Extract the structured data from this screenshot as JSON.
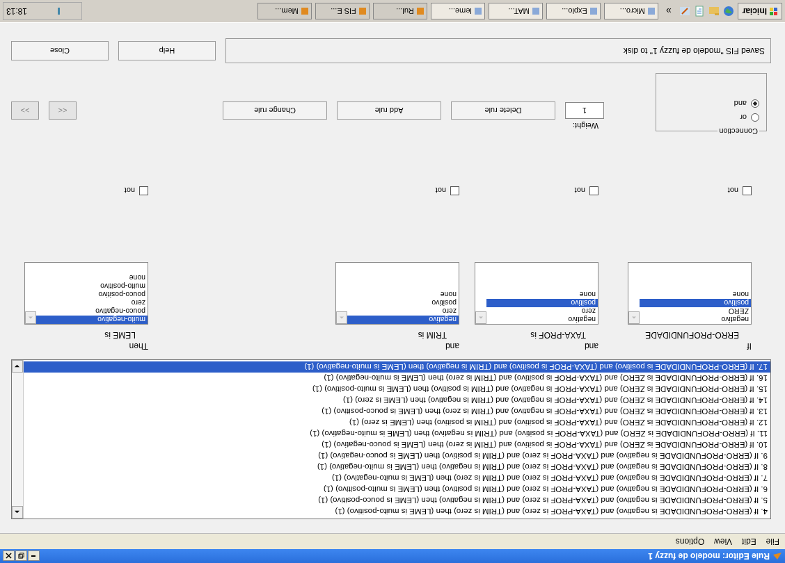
{
  "window": {
    "title": "Rule Editor: modelo de fuzzy 1"
  },
  "menu": [
    "File",
    "Edit",
    "View",
    "Options"
  ],
  "rules": [
    {
      "text": "4. If (ERRO-PROFUNDIDADE is negativo) and (TAXA-PROF is zero) and (TRIM is zero) then (LEME is muito-positivo) (1)",
      "selected": false
    },
    {
      "text": "5. If (ERRO-PROFUNDIDADE is negativo) and (TAXA-PROF is zero) and (TRIM is negativo) then (LEME is pouco-positivo) (1)",
      "selected": false
    },
    {
      "text": "6. If (ERRO-PROFUNDIDADE is negativo) and (TAXA-PROF is zero) and (TRIM is positivo) then (LEME is muito-positivo) (1)",
      "selected": false
    },
    {
      "text": "7. If (ERRO-PROFUNDIDADE is negativo) and (TAXA-PROF is zero) and (TRIM is zero) then (LEME is muito-negativo) (1)",
      "selected": false
    },
    {
      "text": "8. If (ERRO-PROFUNDIDADE is negativo) and (TAXA-PROF is zero) and (TRIM is negativo) then (LEME is muito-negativo) (1)",
      "selected": false
    },
    {
      "text": "9. If (ERRO-PROFUNDIDADE is negativo) and (TAXA-PROF is zero) and (TRIM is positivo) then (LEME is pouco-negativo) (1)",
      "selected": false
    },
    {
      "text": "10. If (ERRO-PROFUNDIDADE is ZERO) and (TAXA-PROF is positivo) and (TRIM is zero) then (LEME is pouco-negativo) (1)",
      "selected": false
    },
    {
      "text": "11. If (ERRO-PROFUNDIDADE is ZERO) and (TAXA-PROF is positivo) and (TRIM is negativo) then (LEME is muito-negativo) (1)",
      "selected": false
    },
    {
      "text": "12. If (ERRO-PROFUNDIDADE is ZERO) and (TAXA-PROF is positivo) and (TRIM is positivo) then (LEME is zero) (1)",
      "selected": false
    },
    {
      "text": "13. If (ERRO-PROFUNDIDADE is ZERO) and (TAXA-PROF is negativo) and (TRIM is zero) then (LEME is pouco-positivo) (1)",
      "selected": false
    },
    {
      "text": "14. If (ERRO-PROFUNDIDADE is ZERO) and (TAXA-PROF is negativo) and (TRIM is negativo) then (LEME is zero) (1)",
      "selected": false
    },
    {
      "text": "15. If (ERRO-PROFUNDIDADE is ZERO) and (TAXA-PROF is negativo) and (TRIM is positivo) then (LEME is muito-positivo) (1)",
      "selected": false
    },
    {
      "text": "16. If (ERRO-PROFUNDIDADE is ZERO) and (TAXA-PROF is positivo) and (TRIM is zero) then (LEME is muito-negativo) (1)",
      "selected": false
    },
    {
      "text": "17. If (ERRO-PROFUNDIDADE is positivo) and (TAXA-PROF is positivo) and (TRIM is negativo) then (LEME is muito-negativo) (1)",
      "selected": true
    }
  ],
  "variables": [
    {
      "prefix": "If",
      "label": "ERRO-PROFUNDIDADE",
      "options": [
        {
          "text": "negativo",
          "selected": false
        },
        {
          "text": "ZERO",
          "selected": false
        },
        {
          "text": "positivo",
          "selected": true
        },
        {
          "text": "none",
          "selected": false
        }
      ],
      "not_label": "not",
      "not_checked": false
    },
    {
      "prefix": "and",
      "label": "TAXA-PROF is",
      "options": [
        {
          "text": "negativo",
          "selected": false
        },
        {
          "text": "zero",
          "selected": false
        },
        {
          "text": "positivo",
          "selected": true
        },
        {
          "text": "none",
          "selected": false
        }
      ],
      "not_label": "not",
      "not_checked": false
    },
    {
      "prefix": "and",
      "label": "TRIM is",
      "options": [
        {
          "text": "negativo",
          "selected": true
        },
        {
          "text": "zero",
          "selected": false
        },
        {
          "text": "positivo",
          "selected": false
        },
        {
          "text": "none",
          "selected": false
        }
      ],
      "not_label": "not",
      "not_checked": false
    },
    {
      "prefix": "Then",
      "label": "LEME is",
      "options": [
        {
          "text": "muito-negativo",
          "selected": true
        },
        {
          "text": "pouco-negativo",
          "selected": false
        },
        {
          "text": "zero",
          "selected": false
        },
        {
          "text": "pouco-positivo",
          "selected": false
        },
        {
          "text": "muito-positivo",
          "selected": false
        },
        {
          "text": "none",
          "selected": false
        }
      ],
      "not_label": "not",
      "not_checked": false
    }
  ],
  "connection": {
    "title": "Connection",
    "options": [
      {
        "label": "or",
        "selected": false
      },
      {
        "label": "and",
        "selected": true
      }
    ]
  },
  "weight": {
    "label": "Weight:",
    "value": "1"
  },
  "buttons": [
    "Delete rule",
    "Add rule",
    "Change rule"
  ],
  "nav_buttons": [
    {
      "label": "<<",
      "disabled": true
    },
    {
      "label": ">>",
      "disabled": true
    }
  ],
  "status": "Saved FIS \"modelo de fuzzy 1\" to disk",
  "bottom_buttons": [
    "Help",
    "Close"
  ],
  "taskbar": {
    "start": "Iniciar",
    "more": "»",
    "tasks": [
      "Micro...",
      "Explo...",
      "MAT...",
      "leme...",
      "Rul...",
      "FIS E...",
      "Mem..."
    ],
    "clock": "18:13"
  }
}
